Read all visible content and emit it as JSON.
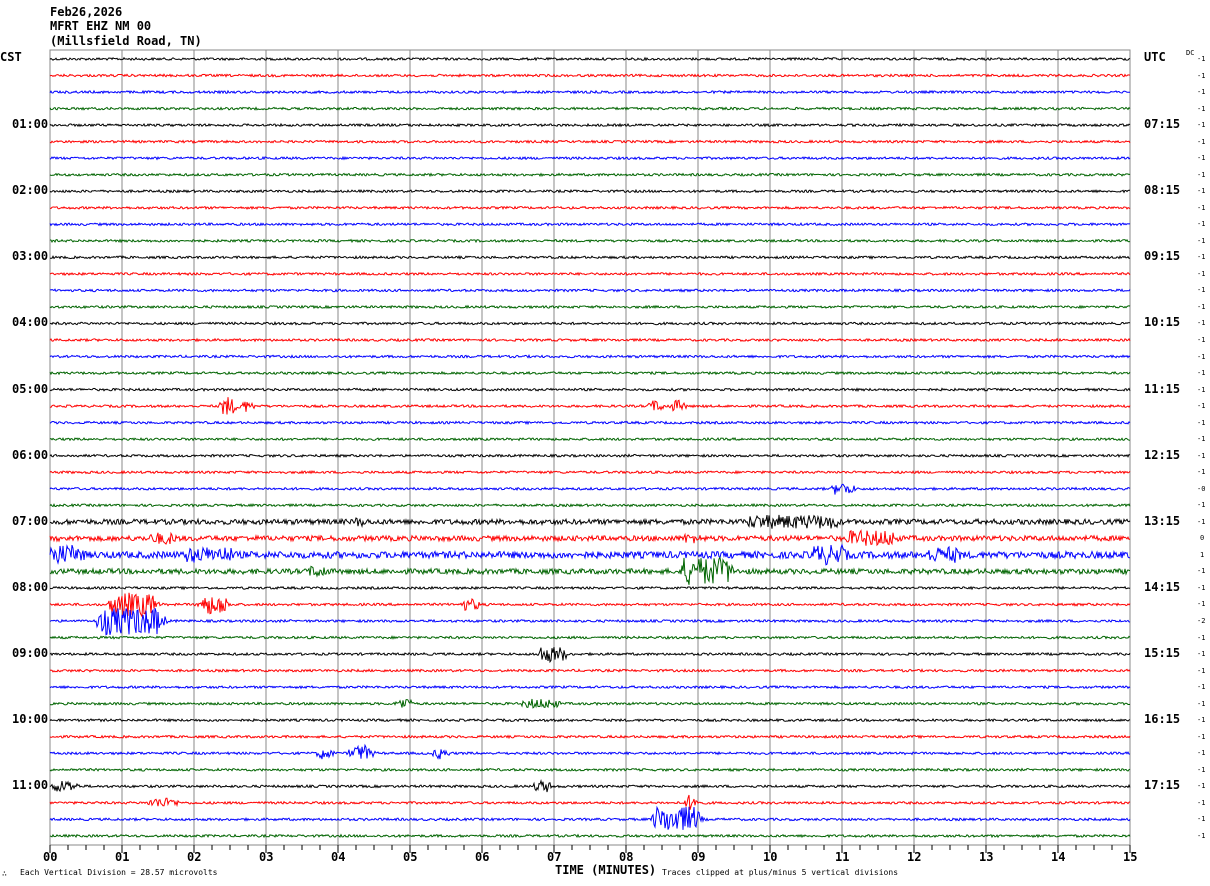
{
  "header": {
    "date": "Feb26,2026",
    "station": "MFRT EHZ NM 00",
    "location": "(Millsfield Road, TN)"
  },
  "left_tz": "CST",
  "right_tz": "UTC",
  "dc_label": "DC",
  "footer": {
    "scale": "Each Vertical Division =   28.57 microvolts",
    "xlabel": "TIME (MINUTES)",
    "clip_note": "Traces clipped at plus/minus 5 vertical divisions",
    "corner": "∴"
  },
  "chart_data": {
    "type": "line",
    "title": "MFRT EHZ NM 00 helicorder",
    "xlabel": "TIME (MINUTES)",
    "xlim": [
      0,
      15
    ],
    "x_ticks": [
      "00",
      "01",
      "02",
      "03",
      "04",
      "05",
      "06",
      "07",
      "08",
      "09",
      "10",
      "11",
      "12",
      "13",
      "14",
      "15"
    ],
    "rows_per_hour": 4,
    "row_count": 48,
    "trace_colors": [
      "#000000",
      "#ff0000",
      "#0000ff",
      "#006400"
    ],
    "left_hour_labels": [
      "01:00",
      "02:00",
      "03:00",
      "04:00",
      "05:00",
      "06:00",
      "07:00",
      "08:00",
      "09:00",
      "10:00",
      "11:00"
    ],
    "right_hour_labels": [
      "07:15",
      "08:15",
      "09:15",
      "10:15",
      "11:15",
      "12:15",
      "13:15",
      "14:15",
      "15:15",
      "16:15",
      "17:15"
    ],
    "dc_offsets": [
      "-1",
      "-1",
      "-1",
      "-1",
      "-1",
      "-1",
      "-1",
      "-1",
      "-1",
      "-1",
      "-1",
      "-1",
      "-1",
      "-1",
      "-1",
      "-1",
      "-1",
      "-1",
      "-1",
      "-1",
      "-1",
      "-1",
      "-1",
      "-1",
      "-1",
      "-1",
      "-0",
      "-1",
      "-1",
      "0",
      "1",
      "-1",
      "-1",
      "-1",
      "-2",
      "-1",
      "-1",
      "-1",
      "-1",
      "-1",
      "-1",
      "-1",
      "-1",
      "-1",
      "-1",
      "-1",
      "-1",
      "-1"
    ],
    "events": [
      {
        "row": 21,
        "start": 2.4,
        "end": 2.5,
        "amp": 10
      },
      {
        "row": 21,
        "start": 2.65,
        "end": 2.75,
        "amp": 6
      },
      {
        "row": 21,
        "start": 8.35,
        "end": 8.45,
        "amp": 6
      },
      {
        "row": 21,
        "start": 8.65,
        "end": 8.75,
        "amp": 6
      },
      {
        "row": 26,
        "start": 10.9,
        "end": 11.1,
        "amp": 6
      },
      {
        "row": 28,
        "start": 4.25,
        "end": 4.35,
        "amp": 5
      },
      {
        "row": 28,
        "start": 9.7,
        "end": 10.9,
        "amp": 7
      },
      {
        "row": 29,
        "start": 1.4,
        "end": 1.7,
        "amp": 6
      },
      {
        "row": 29,
        "start": 8.8,
        "end": 9.0,
        "amp": 5
      },
      {
        "row": 29,
        "start": 11.1,
        "end": 11.7,
        "amp": 8
      },
      {
        "row": 30,
        "start": 0.0,
        "end": 0.4,
        "amp": 10
      },
      {
        "row": 30,
        "start": 1.9,
        "end": 2.5,
        "amp": 8
      },
      {
        "row": 30,
        "start": 10.6,
        "end": 11.0,
        "amp": 10
      },
      {
        "row": 30,
        "start": 12.2,
        "end": 12.6,
        "amp": 8
      },
      {
        "row": 31,
        "start": 3.6,
        "end": 3.8,
        "amp": 6
      },
      {
        "row": 31,
        "start": 8.8,
        "end": 9.4,
        "amp": 14
      },
      {
        "row": 33,
        "start": 0.85,
        "end": 1.4,
        "amp": 12
      },
      {
        "row": 33,
        "start": 2.1,
        "end": 2.4,
        "amp": 10
      },
      {
        "row": 33,
        "start": 5.75,
        "end": 5.9,
        "amp": 6
      },
      {
        "row": 34,
        "start": 0.7,
        "end": 1.5,
        "amp": 14
      },
      {
        "row": 36,
        "start": 6.8,
        "end": 7.1,
        "amp": 8
      },
      {
        "row": 39,
        "start": 4.85,
        "end": 4.95,
        "amp": 6
      },
      {
        "row": 39,
        "start": 6.6,
        "end": 7.0,
        "amp": 5
      },
      {
        "row": 42,
        "start": 3.75,
        "end": 3.85,
        "amp": 6
      },
      {
        "row": 42,
        "start": 4.2,
        "end": 4.4,
        "amp": 8
      },
      {
        "row": 42,
        "start": 5.35,
        "end": 5.45,
        "amp": 6
      },
      {
        "row": 44,
        "start": 0.05,
        "end": 0.3,
        "amp": 6
      },
      {
        "row": 44,
        "start": 6.75,
        "end": 6.9,
        "amp": 6
      },
      {
        "row": 45,
        "start": 1.4,
        "end": 1.7,
        "amp": 5
      },
      {
        "row": 45,
        "start": 8.85,
        "end": 8.95,
        "amp": 8
      },
      {
        "row": 46,
        "start": 8.4,
        "end": 8.95,
        "amp": 13
      }
    ]
  }
}
